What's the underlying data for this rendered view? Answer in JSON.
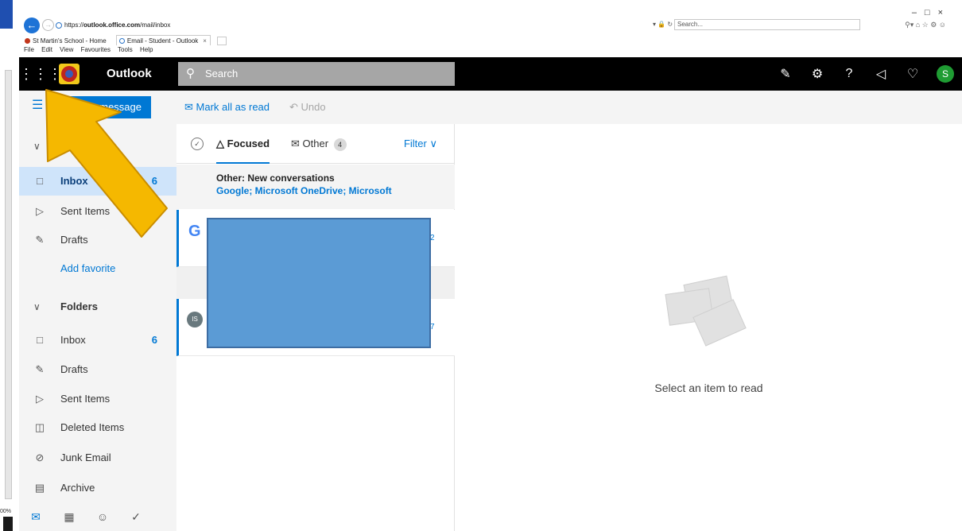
{
  "browser": {
    "url_prefix": "https://",
    "url_host": "outlook.office.com",
    "url_path": "/mail/inbox",
    "search_placeholder": "Search...",
    "tabs": [
      {
        "label": "St Martin's School - Home"
      },
      {
        "label": "Email - Student - Outlook"
      }
    ],
    "menu": [
      "File",
      "Edit",
      "View",
      "Favourites",
      "Tools",
      "Help"
    ],
    "zoom": "00%"
  },
  "topbar": {
    "brand": "Outlook",
    "search_placeholder": "Search",
    "avatar_initial": "S"
  },
  "nav": {
    "new_message": "New message",
    "favorites_header": "Favorites",
    "folders_header": "Folders",
    "favorites": [
      {
        "label": "Inbox",
        "count": "6"
      },
      {
        "label": "Sent Items",
        "count": ""
      },
      {
        "label": "Drafts",
        "count": ""
      }
    ],
    "add_favorite": "Add favorite",
    "folders": [
      {
        "label": "Inbox",
        "count": "6"
      },
      {
        "label": "Drafts",
        "count": ""
      },
      {
        "label": "Sent Items",
        "count": ""
      },
      {
        "label": "Deleted Items",
        "count": ""
      },
      {
        "label": "Junk Email",
        "count": ""
      },
      {
        "label": "Archive",
        "count": ""
      }
    ]
  },
  "commands": {
    "mark_all_read": "Mark all as read",
    "undo": "Undo"
  },
  "list": {
    "tab_focused": "Focused",
    "tab_other": "Other",
    "other_count": "4",
    "filter": "Filter",
    "banner_title": "Other: New conversations",
    "banner_senders": "Google; Microsoft OneDrive; Microsoft",
    "msg1_initial": "G",
    "msg2_initial": "IS",
    "peek1": "2",
    "peek2": "7"
  },
  "reading": {
    "empty_text": "Select an item to read"
  },
  "colors": {
    "accent": "#0078d4",
    "topbar": "#000000",
    "avatar": "#1f9c33",
    "arrow": "#f5b800",
    "redaction": "#5b9bd5"
  }
}
